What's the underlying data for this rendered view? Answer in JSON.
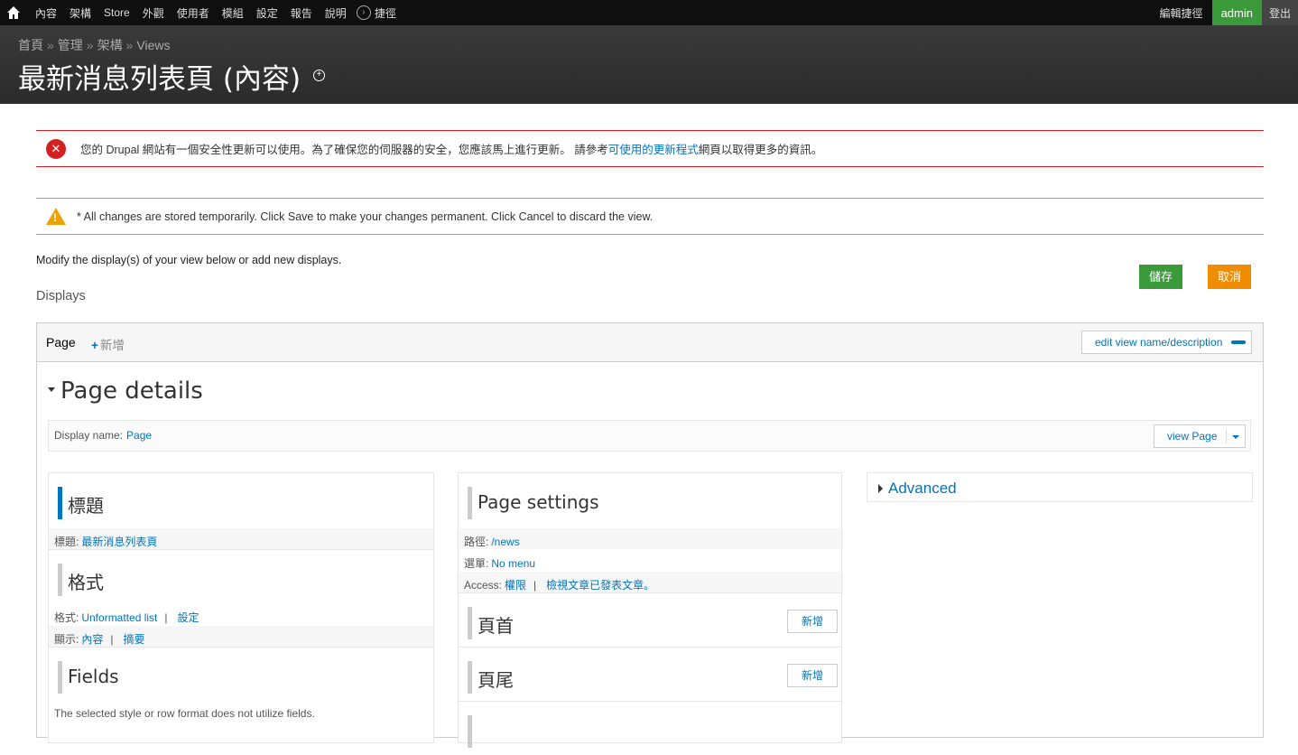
{
  "toolbar": {
    "menu": [
      "內容",
      "架構",
      "Store",
      "外觀",
      "使用者",
      "模組",
      "設定",
      "報告",
      "說明"
    ],
    "shortcuts": "捷徑",
    "edit_shortcuts": "編輯捷徑",
    "user": "admin",
    "logout": "登出"
  },
  "header": {
    "breadcrumb": [
      "首頁",
      "管理",
      "架構",
      "Views"
    ],
    "breadcrumb_sep": "»",
    "title": "最新消息列表頁 (內容)"
  },
  "messages": {
    "error_text": "您的 Drupal 網站有一個安全性更新可以使用。為了確保您的伺服器的安全，您應該馬上進行更新。 請參考",
    "error_link": "可使用的更新程式",
    "error_tail": "網頁以取得更多的資訊。",
    "warning_text": "* All changes are stored temporarily. Click Save to make your changes permanent. Click Cancel to discard the view."
  },
  "intro": "Modify the display(s) of your view below or add new displays.",
  "displays_label": "Displays",
  "buttons": {
    "save": "儲存",
    "cancel": "取消"
  },
  "panel": {
    "tab_page": "Page",
    "tab_add": "新增",
    "edit_view": "edit view name/description",
    "details_title": "Page details",
    "display_name_label": "Display name:",
    "display_name_value": "Page",
    "view_page": "view Page",
    "col1": {
      "title_section": "標題",
      "title_label": "標題:",
      "title_value": "最新消息列表頁",
      "format_section": "格式",
      "format_label": "格式:",
      "format_value": "Unformatted list",
      "format_settings": "設定",
      "show_label": "顯示:",
      "show_value": "內容",
      "show_summary": "摘要",
      "fields_section": "Fields",
      "fields_note": "The selected style or row format does not utilize fields."
    },
    "col2": {
      "settings_section": "Page settings",
      "path_label": "路徑:",
      "path_value": "/news",
      "menu_label": "選單:",
      "menu_value": "No menu",
      "access_label": "Access:",
      "access_value": "權限",
      "access_perm": "檢視文章已發表文章。",
      "header_section": "頁首",
      "footer_section": "頁尾",
      "add": "新增"
    },
    "col3": {
      "advanced": "Advanced"
    }
  },
  "colors": {
    "admin_green": "#3a9a3a",
    "cancel_orange": "#f08c00",
    "link_blue": "#0074bd",
    "error_red": "#d42020",
    "warning_yellow": "#c9a000"
  }
}
